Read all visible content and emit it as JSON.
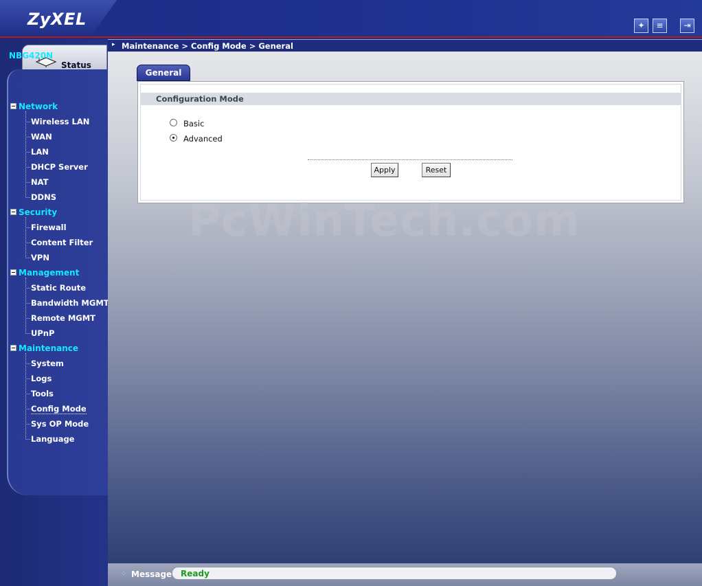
{
  "header": {
    "brand": "ZyXEL",
    "icons": [
      {
        "name": "wizard-icon",
        "glyph": "✦"
      },
      {
        "name": "help-icon",
        "glyph": "≡"
      },
      {
        "name": "logout-icon",
        "glyph": "⇥"
      }
    ]
  },
  "sidebar": {
    "status_tab": "Status",
    "device": "NBG420N",
    "groups": [
      {
        "label": "Network",
        "items": [
          "Wireless LAN",
          "WAN",
          "LAN",
          "DHCP Server",
          "NAT",
          "DDNS"
        ]
      },
      {
        "label": "Security",
        "items": [
          "Firewall",
          "Content Filter",
          "VPN"
        ]
      },
      {
        "label": "Management",
        "items": [
          "Static Route",
          "Bandwidth MGMT",
          "Remote MGMT",
          "UPnP"
        ]
      },
      {
        "label": "Maintenance",
        "items": [
          "System",
          "Logs",
          "Tools",
          "Config Mode",
          "Sys OP Mode",
          "Language"
        ]
      }
    ],
    "active_item": "Config Mode"
  },
  "breadcrumb": "Maintenance > Config Mode > General",
  "main": {
    "tab": "General",
    "section_title": "Configuration Mode",
    "options": [
      {
        "label": "Basic",
        "checked": false
      },
      {
        "label": "Advanced",
        "checked": true
      }
    ],
    "apply_label": "Apply",
    "reset_label": "Reset",
    "watermark": "PcWinTech.com"
  },
  "statusbar": {
    "label": "Message",
    "value": "Ready"
  },
  "colors": {
    "brand_blue": "#1f3190",
    "menu_group": "#16e7ff",
    "header_accent": "#b51b1b",
    "ready_green": "#1f9a1f"
  }
}
